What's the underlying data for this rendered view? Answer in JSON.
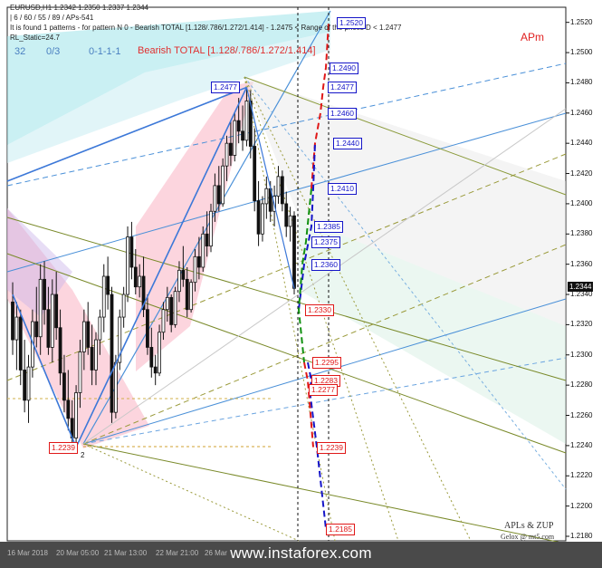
{
  "header": {
    "line1": "EURUSD,H1  1.2342 1.2350 1.2337 1.2344",
    "line2": "| 6 / 60 / 55 / 89 / APs-541",
    "line3": "It is found 1 patterns  -  for pattern N 0 - Bearish TOTAL [1.128/.786/1.272/1.414] - 1.2475 < Range of the prices D < 1.2477",
    "line4": "RL_Static=24.7",
    "stats": [
      "32",
      "0/3",
      "0-1-1-1"
    ]
  },
  "pattern_label": "Bearish TOTAL [1.128/.786/1.272/1.414]",
  "apm_label": "APm",
  "brand": {
    "line1": "APLs & ZUP",
    "line2": "Gelox @ mt5.com"
  },
  "watermark": "www.instaforex.com",
  "current_price": "1.2344",
  "colors": {
    "blue": "#1515c8",
    "red": "#e01818",
    "green": "#109010",
    "pink": "#f7a8b8",
    "cyan": "#5ec8d8"
  },
  "chart_data": {
    "type": "candlestick",
    "symbol": "EURUSD",
    "timeframe": "H1",
    "ylim": [
      1.2177,
      1.253
    ],
    "y_ticks": [
      "1.2520",
      "1.2500",
      "1.2480",
      "1.2460",
      "1.2440",
      "1.2420",
      "1.2400",
      "1.2380",
      "1.2360",
      "1.2340",
      "1.2320",
      "1.2300",
      "1.2280",
      "1.2260",
      "1.2240",
      "1.2220",
      "1.2200",
      "1.2180"
    ],
    "x_ticks": [
      "16 Mar 2018",
      "20 Mar 05:00",
      "21 Mar 13:00",
      "22 Mar 21:00",
      "26 Mar"
    ],
    "levels_blue": [
      "1.2520",
      "1.2490",
      "1.2477",
      "1.2460",
      "1.2440",
      "1.2410",
      "1.2385",
      "1.2375",
      "1.2360"
    ],
    "levels_red": [
      "1.2330",
      "1.2295",
      "1.2283",
      "1.2277",
      "1.2239",
      "1.2185"
    ],
    "point_labels": {
      "low": "1.2239",
      "high": "1.2477",
      "point_2": "2"
    },
    "candles": [
      [
        1.2335,
        1.2348,
        1.23,
        1.231
      ],
      [
        1.231,
        1.2335,
        1.229,
        1.2325
      ],
      [
        1.2325,
        1.233,
        1.228,
        1.229
      ],
      [
        1.229,
        1.231,
        1.2262,
        1.227
      ],
      [
        1.227,
        1.23,
        1.2255,
        1.2292
      ],
      [
        1.2292,
        1.233,
        1.2285,
        1.2322
      ],
      [
        1.2322,
        1.2345,
        1.2305,
        1.2312
      ],
      [
        1.2312,
        1.236,
        1.23,
        1.235
      ],
      [
        1.235,
        1.2362,
        1.232,
        1.233
      ],
      [
        1.233,
        1.2345,
        1.23,
        1.2305
      ],
      [
        1.2305,
        1.235,
        1.2295,
        1.234
      ],
      [
        1.234,
        1.2355,
        1.231,
        1.2318
      ],
      [
        1.2318,
        1.233,
        1.228,
        1.2288
      ],
      [
        1.2288,
        1.23,
        1.2262,
        1.227
      ],
      [
        1.227,
        1.229,
        1.225,
        1.2258
      ],
      [
        1.2258,
        1.227,
        1.2239,
        1.2245
      ],
      [
        1.2245,
        1.228,
        1.2239,
        1.2275
      ],
      [
        1.2275,
        1.231,
        1.2265,
        1.2302
      ],
      [
        1.2302,
        1.233,
        1.229,
        1.2322
      ],
      [
        1.2322,
        1.2335,
        1.23,
        1.2305
      ],
      [
        1.2305,
        1.232,
        1.228,
        1.229
      ],
      [
        1.229,
        1.2315,
        1.228,
        1.231
      ],
      [
        1.231,
        1.233,
        1.23,
        1.2325
      ],
      [
        1.2325,
        1.236,
        1.2315,
        1.2352
      ],
      [
        1.2352,
        1.2365,
        1.233,
        1.234
      ],
      [
        1.234,
        1.2345,
        1.2255,
        1.2262
      ],
      [
        1.2262,
        1.23,
        1.2258,
        1.2295
      ],
      [
        1.2295,
        1.233,
        1.229,
        1.2325
      ],
      [
        1.2325,
        1.2345,
        1.2318,
        1.234
      ],
      [
        1.234,
        1.2385,
        1.2335,
        1.2378
      ],
      [
        1.2378,
        1.2388,
        1.235,
        1.2358
      ],
      [
        1.2358,
        1.237,
        1.234,
        1.2345
      ],
      [
        1.2345,
        1.236,
        1.2338,
        1.2352
      ],
      [
        1.2352,
        1.2365,
        1.2325,
        1.233
      ],
      [
        1.233,
        1.234,
        1.23,
        1.2305
      ],
      [
        1.2305,
        1.2318,
        1.2285,
        1.2292
      ],
      [
        1.2292,
        1.23,
        1.228,
        1.2288
      ],
      [
        1.2288,
        1.232,
        1.2286,
        1.2315
      ],
      [
        1.2315,
        1.2335,
        1.231,
        1.233
      ],
      [
        1.233,
        1.2345,
        1.2322,
        1.2338
      ],
      [
        1.2338,
        1.234,
        1.2315,
        1.232
      ],
      [
        1.232,
        1.2345,
        1.2318,
        1.2342
      ],
      [
        1.2342,
        1.2362,
        1.2335,
        1.2356
      ],
      [
        1.2356,
        1.2372,
        1.2345,
        1.235
      ],
      [
        1.235,
        1.2358,
        1.2325,
        1.233
      ],
      [
        1.233,
        1.235,
        1.2328,
        1.2348
      ],
      [
        1.2348,
        1.237,
        1.2342,
        1.2365
      ],
      [
        1.2365,
        1.2378,
        1.235,
        1.2358
      ],
      [
        1.2358,
        1.2385,
        1.2355,
        1.238
      ],
      [
        1.238,
        1.2395,
        1.2365,
        1.2372
      ],
      [
        1.2372,
        1.24,
        1.2368,
        1.2395
      ],
      [
        1.2395,
        1.242,
        1.2388,
        1.2412
      ],
      [
        1.2412,
        1.2425,
        1.2395,
        1.24
      ],
      [
        1.24,
        1.243,
        1.2398,
        1.2425
      ],
      [
        1.2425,
        1.2445,
        1.2415,
        1.244
      ],
      [
        1.244,
        1.2455,
        1.2425,
        1.2432
      ],
      [
        1.2432,
        1.246,
        1.2428,
        1.2455
      ],
      [
        1.2455,
        1.247,
        1.244,
        1.2448
      ],
      [
        1.2448,
        1.2465,
        1.2435,
        1.2442
      ],
      [
        1.2442,
        1.2477,
        1.2438,
        1.2468
      ],
      [
        1.2468,
        1.2475,
        1.243,
        1.2438
      ],
      [
        1.2438,
        1.245,
        1.2395,
        1.2402
      ],
      [
        1.2402,
        1.2415,
        1.2372,
        1.238
      ],
      [
        1.238,
        1.2405,
        1.2375,
        1.24
      ],
      [
        1.24,
        1.2418,
        1.239,
        1.241
      ],
      [
        1.241,
        1.2415,
        1.2388,
        1.2395
      ],
      [
        1.2395,
        1.2412,
        1.2385,
        1.2405
      ],
      [
        1.2405,
        1.2425,
        1.24,
        1.2418
      ],
      [
        1.2418,
        1.2422,
        1.2395,
        1.24
      ],
      [
        1.24,
        1.2408,
        1.2378,
        1.2385
      ],
      [
        1.2385,
        1.2398,
        1.2375,
        1.2392
      ],
      [
        1.2392,
        1.2395,
        1.234,
        1.2344
      ]
    ],
    "pattern_points": [
      [
        1.234,
        1.2239
      ],
      [
        1.2239,
        1.2477
      ],
      [
        1.2477,
        1.2344
      ]
    ]
  }
}
